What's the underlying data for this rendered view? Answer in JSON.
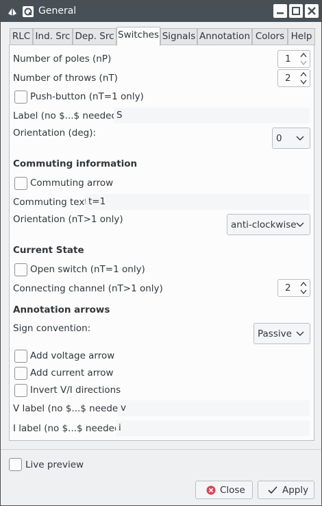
{
  "window": {
    "title": "General"
  },
  "tabs": [
    "RLC",
    "Ind. Src",
    "Dep. Src",
    "Switches",
    "Signals",
    "Annotation",
    "Colors",
    "Help"
  ],
  "active_tab": "Switches",
  "poles": {
    "label": "Number of poles (nP)",
    "value": "1"
  },
  "throws": {
    "label": "Number of throws (nT)",
    "value": "2"
  },
  "push_button": {
    "label": "Push-button (nT=1 only)",
    "checked": false
  },
  "switch_label": {
    "label": "Label (no $...$ needed)",
    "value": "S"
  },
  "orientation": {
    "label": "Orientation (deg):",
    "value": "0"
  },
  "commuting": {
    "heading": "Commuting information",
    "arrow_label": "Commuting arrow",
    "arrow_checked": false,
    "text_label": "Commuting text",
    "text_value": "t=1",
    "orientation_label": "Orientation (nT>1 only)",
    "orientation_value": "anti-clockwise"
  },
  "current_state": {
    "heading": "Current State",
    "open_label": "Open switch (nT=1 only)",
    "open_checked": false,
    "channel_label": "Connecting channel (nT>1 only)",
    "channel_value": "2"
  },
  "annotation": {
    "heading": "Annotation arrows",
    "sign_label": "Sign convention:",
    "sign_value": "Passive",
    "voltage_label": "Add voltage arrow",
    "current_label": "Add current arrow",
    "invert_label": "Invert V/I directions",
    "v_label_label": "V label (no $...$ needed)",
    "v_label_value": "v",
    "i_label_label": "I label (no $...$ needed)",
    "i_label_value": "i"
  },
  "live_preview": {
    "label": "Live preview",
    "checked": false
  },
  "buttons": {
    "close": "Close",
    "apply": "Apply"
  },
  "colors": {
    "titlebar": "#475057",
    "close_icon": "#da4453",
    "accent": "#3daee9"
  }
}
